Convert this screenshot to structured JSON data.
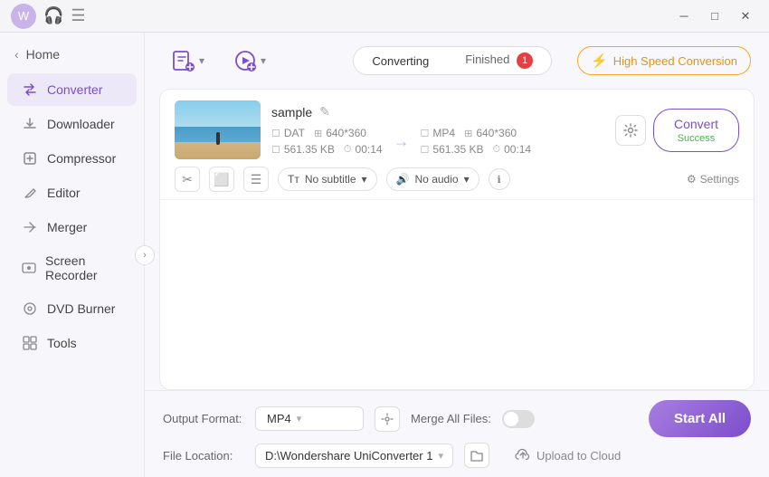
{
  "titlebar": {
    "minimize_label": "─",
    "maximize_label": "□",
    "close_label": "✕"
  },
  "sidebar": {
    "home_label": "Home",
    "items": [
      {
        "id": "converter",
        "label": "Converter",
        "icon": "⇄",
        "active": true
      },
      {
        "id": "downloader",
        "label": "Downloader",
        "icon": "↓"
      },
      {
        "id": "compressor",
        "label": "Compressor",
        "icon": "⊡"
      },
      {
        "id": "editor",
        "label": "Editor",
        "icon": "✂"
      },
      {
        "id": "merger",
        "label": "Merger",
        "icon": "⊞"
      },
      {
        "id": "screen-recorder",
        "label": "Screen Recorder",
        "icon": "◉"
      },
      {
        "id": "dvd-burner",
        "label": "DVD Burner",
        "icon": "⊙"
      },
      {
        "id": "tools",
        "label": "Tools",
        "icon": "⊞"
      }
    ]
  },
  "toolbar": {
    "add_file_icon": "📄",
    "add_icon": "➕",
    "converting_tab": "Converting",
    "finished_tab": "Finished",
    "finished_badge": "1",
    "high_speed_label": "High Speed Conversion"
  },
  "file": {
    "name": "sample",
    "from_format": "DAT",
    "from_resolution": "640*360",
    "from_size": "561.35 KB",
    "from_duration": "00:14",
    "to_format": "MP4",
    "to_resolution": "640*360",
    "to_size": "561.35 KB",
    "to_duration": "00:14",
    "convert_label": "Convert",
    "success_label": "Success",
    "subtitle_label": "No subtitle",
    "audio_label": "No audio",
    "settings_label": "Settings"
  },
  "bottom": {
    "output_format_label": "Output Format:",
    "output_format_value": "MP4",
    "file_location_label": "File Location:",
    "file_location_value": "D:\\Wondershare UniConverter 1",
    "merge_files_label": "Merge All Files:",
    "upload_cloud_label": "Upload to Cloud",
    "start_all_label": "Start All"
  }
}
